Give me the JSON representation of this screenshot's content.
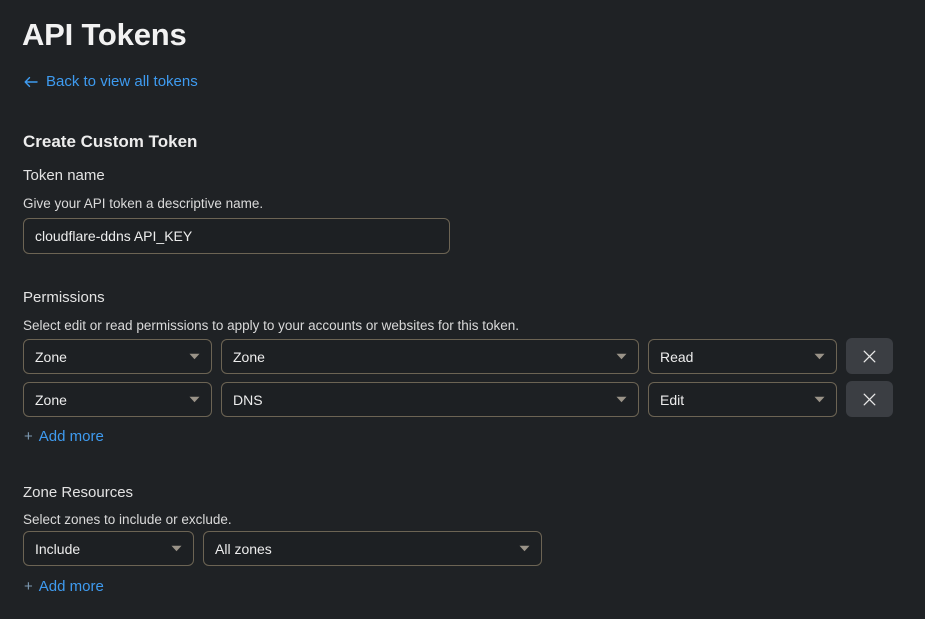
{
  "page": {
    "title": "API Tokens",
    "back_link": {
      "label": "Back to view all tokens",
      "icon": "arrow-left-icon"
    },
    "section_heading": "Create Custom Token",
    "link_color": "#3e9bf0",
    "background_color": "#1f2225",
    "border_color": "#6c6454"
  },
  "token_name": {
    "label": "Token name",
    "description": "Give your API token a descriptive name.",
    "value": "cloudflare-ddns API_KEY",
    "placeholder": ""
  },
  "permissions": {
    "label": "Permissions",
    "description": "Select edit or read permissions to apply to your accounts or websites for this token.",
    "rows": [
      {
        "scope": "Zone",
        "resource": "Zone",
        "access": "Read",
        "remove_label": "×"
      },
      {
        "scope": "Zone",
        "resource": "DNS",
        "access": "Edit",
        "remove_label": "×"
      }
    ],
    "add_more": "Add more",
    "add_more_plus": "+"
  },
  "zone_resources": {
    "label": "Zone Resources",
    "description": "Select zones to include or exclude.",
    "rows": [
      {
        "mode": "Include",
        "target": "All zones"
      }
    ],
    "add_more": "Add more",
    "add_more_plus": "+"
  }
}
